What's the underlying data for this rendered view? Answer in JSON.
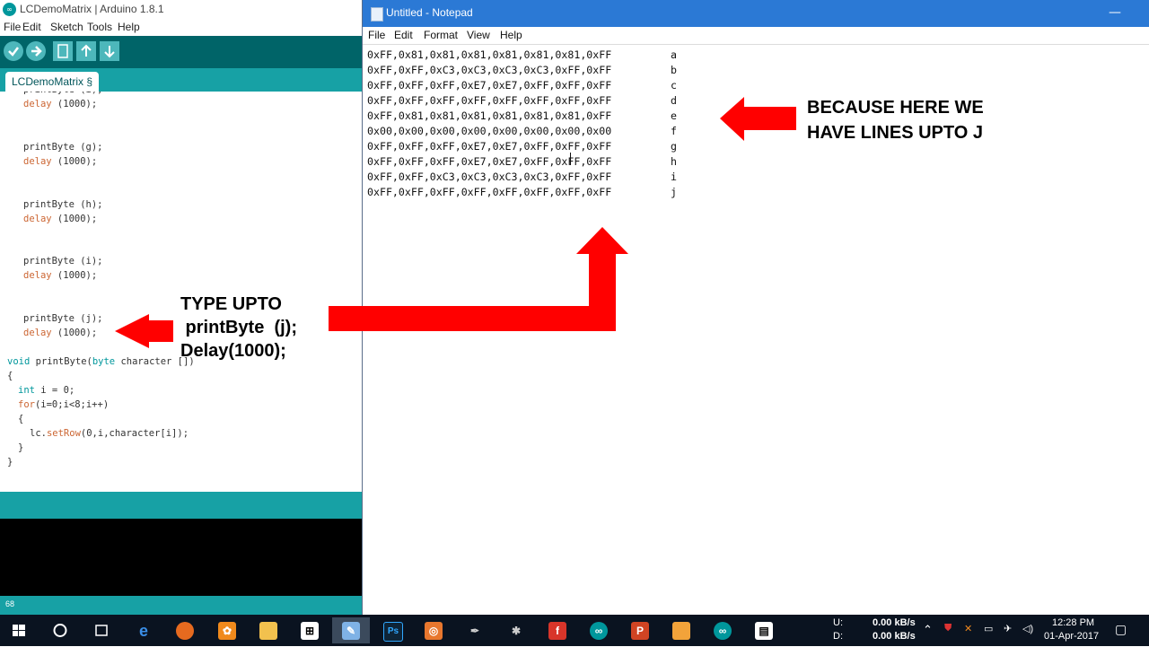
{
  "arduino": {
    "title": "LCDemoMatrix | Arduino 1.8.1",
    "menu": [
      "File",
      "Edit",
      "Sketch",
      "Tools",
      "Help"
    ],
    "tab_label": "LCDemoMatrix §",
    "code_lines": [
      {
        "t": "  printByte (i);",
        "k": "cut"
      },
      {
        "t": "  delay (1000);",
        "k": "delay"
      },
      {
        "t": "",
        "k": ""
      },
      {
        "t": "",
        "k": ""
      },
      {
        "t": "  printByte (g);",
        "k": ""
      },
      {
        "t": "  delay (1000);",
        "k": "delay"
      },
      {
        "t": "",
        "k": ""
      },
      {
        "t": "",
        "k": ""
      },
      {
        "t": "  printByte (h);",
        "k": ""
      },
      {
        "t": "  delay (1000);",
        "k": "delay"
      },
      {
        "t": "",
        "k": ""
      },
      {
        "t": "",
        "k": ""
      },
      {
        "t": "  printByte (i);",
        "k": ""
      },
      {
        "t": "  delay (1000);",
        "k": "delay"
      },
      {
        "t": "",
        "k": ""
      },
      {
        "t": "",
        "k": ""
      },
      {
        "t": "  printByte (j);",
        "k": ""
      },
      {
        "t": "  delay (1000);",
        "k": "delay"
      },
      {
        "t": "",
        "k": ""
      },
      {
        "t": "void printByte(byte character [])",
        "k": "void"
      },
      {
        "t": "{",
        "k": ""
      },
      {
        "t": "  int i = 0;",
        "k": "int"
      },
      {
        "t": "  for(i=0;i<8;i++)",
        "k": "for"
      },
      {
        "t": "  {",
        "k": ""
      },
      {
        "t": "    lc.setRow(0,i,character[i]);",
        "k": "setrow"
      },
      {
        "t": "  }",
        "k": ""
      },
      {
        "t": "}",
        "k": ""
      }
    ],
    "status_line": "68"
  },
  "notepad": {
    "title": "Untitled - Notepad",
    "menu": [
      "File",
      "Edit",
      "Format",
      "View",
      "Help"
    ],
    "rows": [
      {
        "hex": "0xFF,0x81,0x81,0x81,0x81,0x81,0x81,0xFF",
        "letter": "a"
      },
      {
        "hex": "0xFF,0xFF,0xC3,0xC3,0xC3,0xC3,0xFF,0xFF",
        "letter": "b"
      },
      {
        "hex": "0xFF,0xFF,0xFF,0xE7,0xE7,0xFF,0xFF,0xFF",
        "letter": "c"
      },
      {
        "hex": "0xFF,0xFF,0xFF,0xFF,0xFF,0xFF,0xFF,0xFF",
        "letter": "d"
      },
      {
        "hex": "0xFF,0x81,0x81,0x81,0x81,0x81,0x81,0xFF",
        "letter": "e"
      },
      {
        "hex": "0x00,0x00,0x00,0x00,0x00,0x00,0x00,0x00",
        "letter": "f"
      },
      {
        "hex": "0xFF,0xFF,0xFF,0xE7,0xE7,0xFF,0xFF,0xFF",
        "letter": "g"
      },
      {
        "hex": "0xFF,0xFF,0xFF,0xE7,0xE7,0xFF,0xFF,0xFF",
        "letter": "h"
      },
      {
        "hex": "0xFF,0xFF,0xC3,0xC3,0xC3,0xC3,0xFF,0xFF",
        "letter": "i"
      },
      {
        "hex": "0xFF,0xFF,0xFF,0xFF,0xFF,0xFF,0xFF,0xFF",
        "letter": "j"
      }
    ]
  },
  "annotations": {
    "right_line1": "BECAUSE  HERE WE",
    "right_line2": "HAVE LINES UPTO J",
    "left_line1": "TYPE UPTO",
    "left_line2": " printByte  (j);",
    "left_line3": "Delay(1000);",
    "arrow_color": "#ff0000"
  },
  "taskbar": {
    "apps": [
      "windows-start",
      "cortana-circle",
      "task-view",
      "edge",
      "firefox",
      "uc-browser",
      "file-explorer",
      "store",
      "notepad",
      "photoshop",
      "orange-app",
      "pen-app",
      "atom-app",
      "foxit",
      "arduino",
      "powerpoint",
      "paint",
      "arduino",
      "video-editor"
    ],
    "net_up_label": "U:",
    "net_down_label": "D:",
    "net_up": "0.00 kB/s",
    "net_down": "0.00 kB/s",
    "time": "12:28 PM",
    "date": "01-Apr-2017"
  }
}
